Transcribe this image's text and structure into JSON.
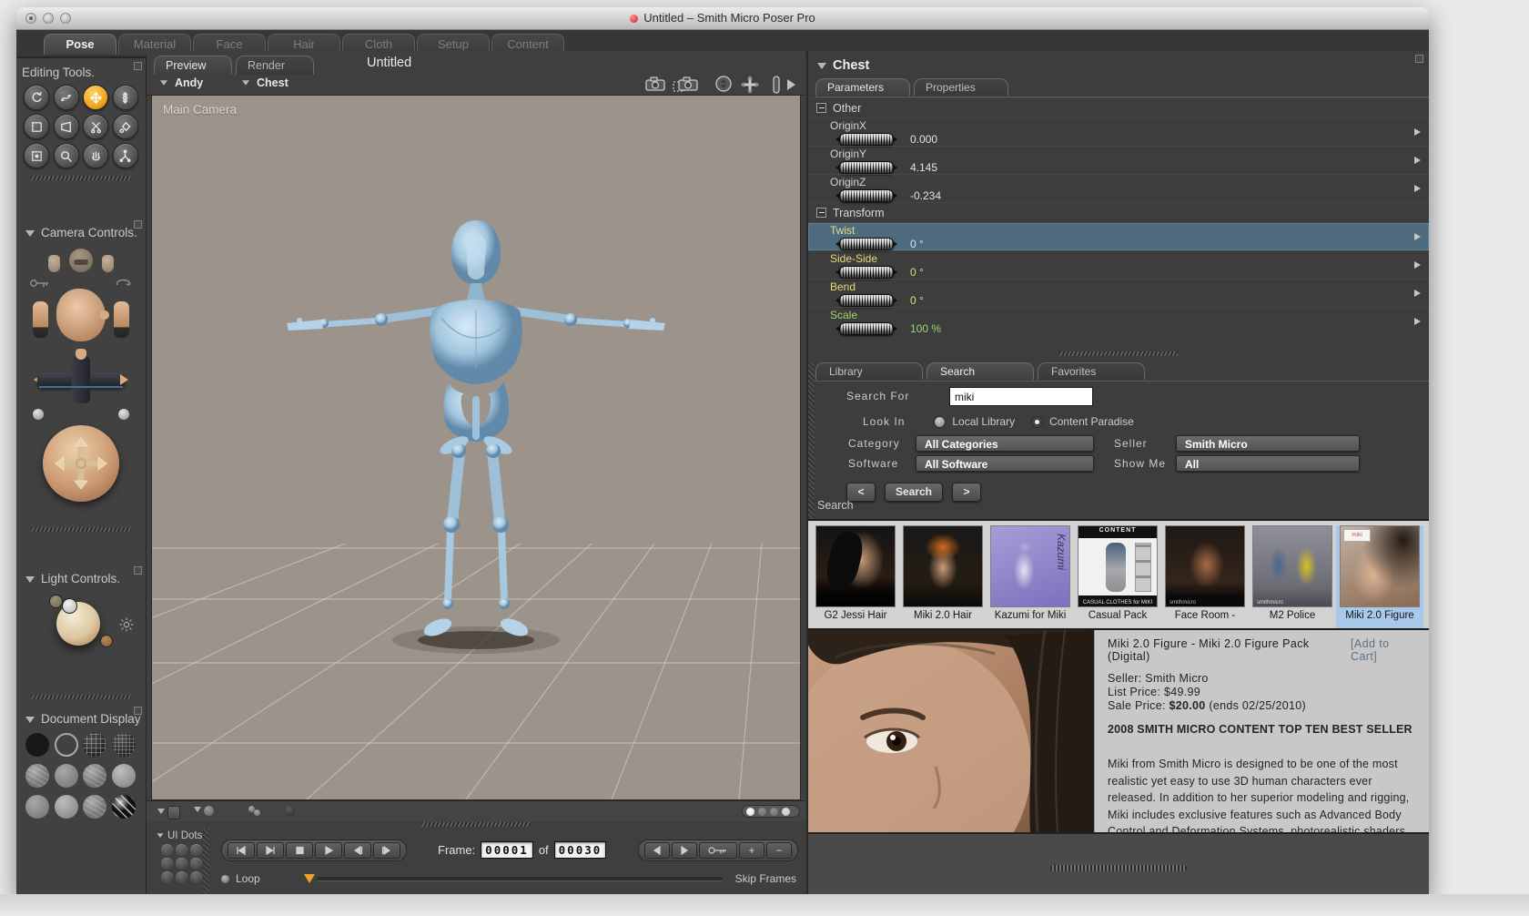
{
  "window": {
    "title": "Untitled – Smith Micro Poser Pro"
  },
  "main_tabs": {
    "pose": "Pose",
    "material": "Material",
    "face": "Face",
    "hair": "Hair",
    "cloth": "Cloth",
    "setup": "Setup",
    "content": "Content"
  },
  "sidebar": {
    "editing_tools_title": "Editing Tools.",
    "camera_controls_title": "Camera Controls.",
    "light_controls_title": "Light Controls.",
    "document_display_title": "Document Display"
  },
  "viewport": {
    "preview_tab": "Preview",
    "render_tab": "Render",
    "doc_title": "Untitled",
    "figure_menu": "Andy",
    "actor_menu": "Chest",
    "camera_label": "Main Camera"
  },
  "animation": {
    "ui_dots": "UI Dots",
    "frame_label": "Frame:",
    "current": "00001",
    "of": "of",
    "total": "00030",
    "loop": "Loop",
    "skip_frames": "Skip Frames"
  },
  "params": {
    "actor": "Chest",
    "tab_parameters": "Parameters",
    "tab_properties": "Properties",
    "group_other": "Other",
    "group_transform": "Transform",
    "rows": [
      {
        "label": "OriginX",
        "value": "0.000"
      },
      {
        "label": "OriginY",
        "value": "4.145"
      },
      {
        "label": "OriginZ",
        "value": "-0.234"
      },
      {
        "label": "Twist",
        "value": "0 °"
      },
      {
        "label": "Side-Side",
        "value": "0 °"
      },
      {
        "label": "Bend",
        "value": "0 °"
      },
      {
        "label": "Scale",
        "value": "100 %"
      }
    ]
  },
  "library": {
    "tab_library": "Library",
    "tab_search": "Search",
    "tab_favorites": "Favorites",
    "search_for": "Search For",
    "search_value": "miki",
    "look_in": "Look In",
    "local_library": "Local Library",
    "content_paradise": "Content Paradise",
    "category": "Category",
    "category_value": "All Categories",
    "seller": "Seller",
    "seller_value": "Smith Micro",
    "software": "Software",
    "software_value": "All Software",
    "show_me": "Show Me",
    "show_me_value": "All",
    "prev": "<",
    "search_btn": "Search",
    "next": ">",
    "results_heading": "Search",
    "results": [
      {
        "name": "G2 Jessi Hair"
      },
      {
        "name": "Miki 2.0 Hair"
      },
      {
        "name": "Kazumi for Miki",
        "art_text": "Kazumi"
      },
      {
        "name": "Casual Pack",
        "art_top": "CONTENT",
        "art_bottom": "CASUAL CLOTHES for MIKI"
      },
      {
        "name": "Face Room -",
        "art_bottom": "smithmicro"
      },
      {
        "name": "M2 Police",
        "art_bottom": "smithmicro"
      },
      {
        "name": "Miki 2.0 Figure",
        "art_top": "miki"
      }
    ]
  },
  "detail": {
    "title": "Miki 2.0 Figure - Miki 2.0 Figure Pack (Digital)",
    "add_to_cart": "[Add to Cart]",
    "seller": "Seller: Smith Micro",
    "list_price": "List Price: $49.99",
    "sale_label": "Sale Price: ",
    "sale_bold": "$20.00",
    "sale_rest": " (ends 02/25/2010)",
    "banner": "2008 SMITH MICRO CONTENT TOP TEN BEST SELLER",
    "description": "Miki from Smith Micro is designed to be one of the most realistic yet easy to use 3D human characters ever released. In addition to her superior modeling and rigging, Miki includes exclusive features such as Advanced Body Control and Deformation Systems, photorealistic shaders and incredibly life-like facial expression morphs similar to those delivered in Generation 2 (G2) figures. Miki is Poser Face Room compatible, and is one of the most"
  },
  "colors": {
    "accent_orange": "#f0a21c",
    "highlight_row": "#4d6a7e",
    "selected_thumb": "#a9c9ea",
    "param_yellow": "#e4de7c",
    "param_green": "#9fd66e",
    "viewport_bg": "#9c938b",
    "figure_blue": "#a8cbe2"
  }
}
